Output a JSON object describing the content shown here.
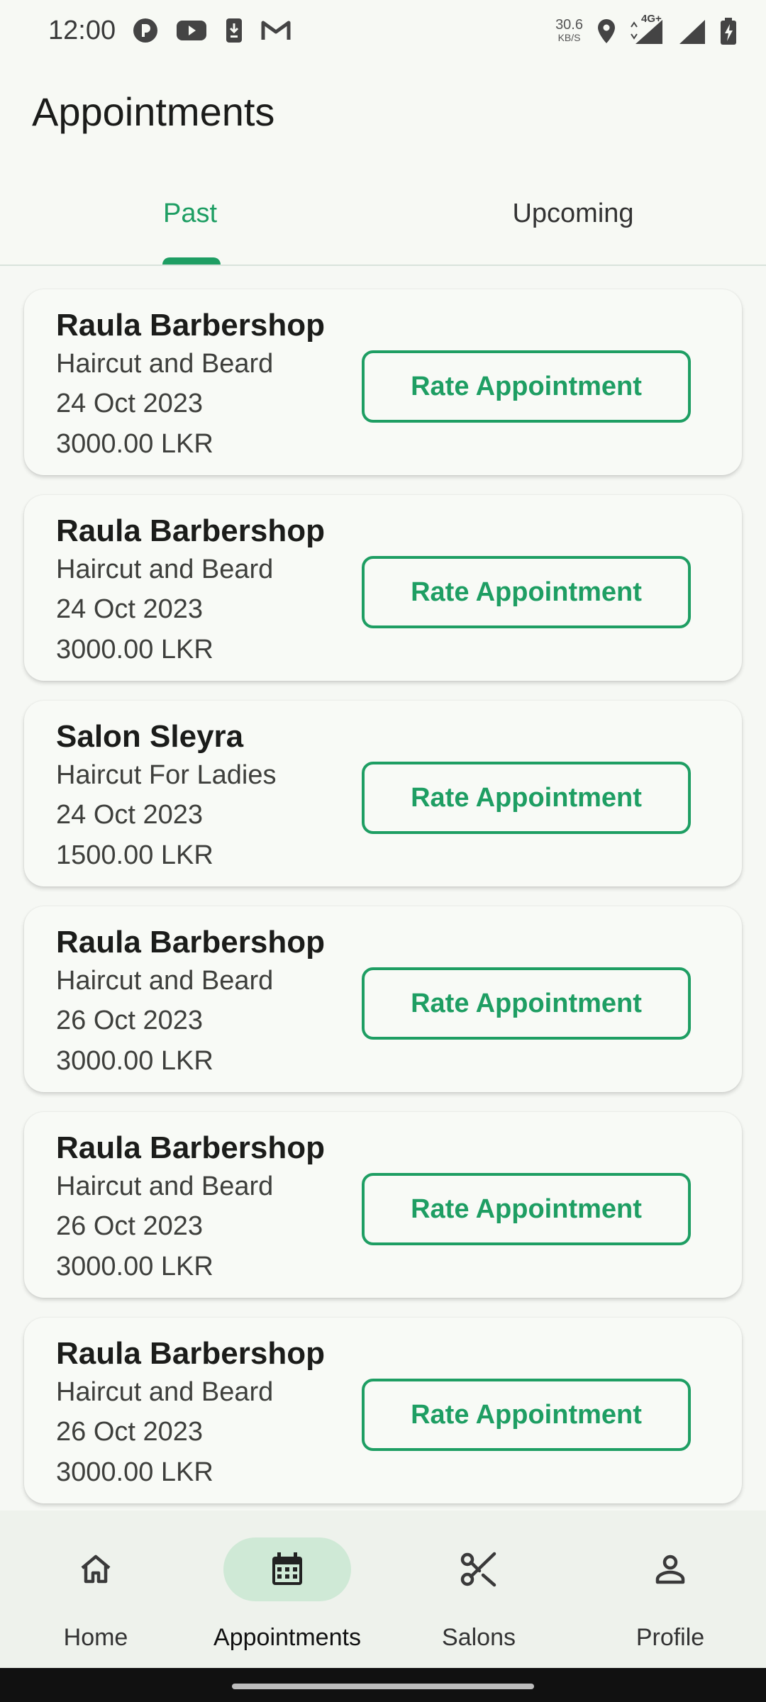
{
  "status_bar": {
    "time": "12:00",
    "speed_value": "30.6",
    "speed_unit": "KB/S",
    "network": "4G+",
    "icons_left": [
      "app-icon",
      "youtube-icon",
      "download-icon",
      "gmail-icon"
    ],
    "icons_right": [
      "location-icon",
      "signal-icon",
      "signal-icon",
      "battery-charging-icon"
    ]
  },
  "page": {
    "title": "Appointments"
  },
  "tabs": [
    {
      "label": "Past",
      "selected": true
    },
    {
      "label": "Upcoming",
      "selected": false
    }
  ],
  "appointments": [
    {
      "salon": "Raula Barbershop",
      "service": "Haircut and Beard",
      "date": "24 Oct 2023",
      "price": "3000.00 LKR",
      "action": "Rate Appointment"
    },
    {
      "salon": "Raula Barbershop",
      "service": "Haircut and Beard",
      "date": "24 Oct 2023",
      "price": "3000.00 LKR",
      "action": "Rate Appointment"
    },
    {
      "salon": "Salon Sleyra",
      "service": "Haircut For Ladies",
      "date": "24 Oct 2023",
      "price": "1500.00 LKR",
      "action": "Rate Appointment"
    },
    {
      "salon": "Raula Barbershop",
      "service": "Haircut and Beard",
      "date": "26 Oct 2023",
      "price": "3000.00 LKR",
      "action": "Rate Appointment"
    },
    {
      "salon": "Raula Barbershop",
      "service": "Haircut and Beard",
      "date": "26 Oct 2023",
      "price": "3000.00 LKR",
      "action": "Rate Appointment"
    },
    {
      "salon": "Raula Barbershop",
      "service": "Haircut and Beard",
      "date": "26 Oct 2023",
      "price": "3000.00 LKR",
      "action": "Rate Appointment"
    }
  ],
  "bottom_nav": [
    {
      "label": "Home",
      "icon": "home-icon",
      "active": false
    },
    {
      "label": "Appointments",
      "icon": "calendar-icon",
      "active": true
    },
    {
      "label": "Salons",
      "icon": "scissors-icon",
      "active": false
    },
    {
      "label": "Profile",
      "icon": "person-icon",
      "active": false
    }
  ],
  "colors": {
    "accent": "#1e9e63",
    "background": "#f6f8f4",
    "nav_active_pill": "#cfe9d6"
  }
}
